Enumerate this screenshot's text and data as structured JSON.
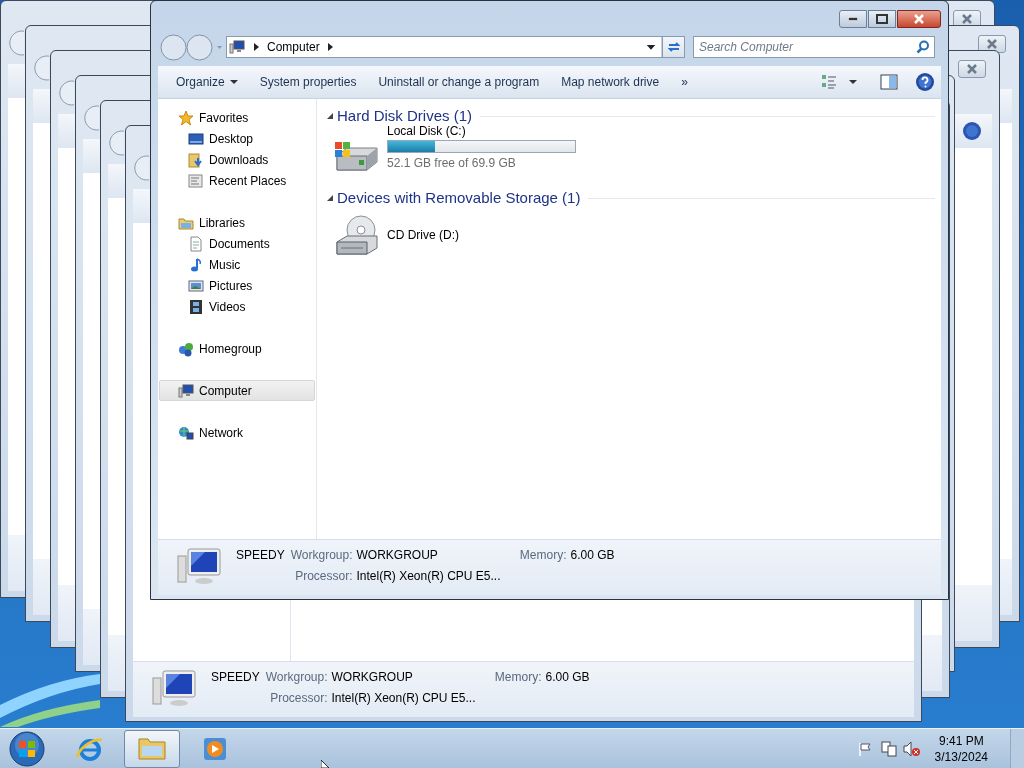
{
  "back_window": {
    "details": {
      "name": "SPEEDY",
      "fields": [
        {
          "label": "Workgroup:",
          "value": "WORKGROUP"
        },
        {
          "label": "Memory:",
          "value": "6.00 GB"
        },
        {
          "label": "Processor:",
          "value": "Intel(R) Xeon(R) CPU E5..."
        }
      ]
    }
  },
  "window": {
    "address": {
      "crumbs": [
        "Computer"
      ]
    },
    "search": {
      "placeholder": "Search Computer"
    },
    "toolbar": [
      {
        "label": "Organize",
        "kind": "menu"
      },
      {
        "label": "System properties",
        "kind": "button"
      },
      {
        "label": "Uninstall or change a program",
        "kind": "button"
      },
      {
        "label": "Map network drive",
        "kind": "button"
      },
      {
        "label": "»",
        "kind": "button"
      }
    ],
    "nav": [
      {
        "label": "Favorites",
        "kind": "star",
        "selected": false,
        "children": [
          {
            "label": "Desktop",
            "kind": "desktop",
            "selected": false
          },
          {
            "label": "Downloads",
            "kind": "downloads",
            "selected": false
          },
          {
            "label": "Recent Places",
            "kind": "recent",
            "selected": false
          }
        ]
      },
      {
        "label": "Libraries",
        "kind": "library",
        "selected": false,
        "children": [
          {
            "label": "Documents",
            "kind": "document",
            "selected": false
          },
          {
            "label": "Music",
            "kind": "music",
            "selected": false
          },
          {
            "label": "Pictures",
            "kind": "pictures",
            "selected": false
          },
          {
            "label": "Videos",
            "kind": "videos",
            "selected": false
          }
        ]
      },
      {
        "label": "Homegroup",
        "kind": "homegroup",
        "selected": false
      },
      {
        "label": "Computer",
        "kind": "computer",
        "selected": true
      },
      {
        "label": "Network",
        "kind": "network",
        "selected": false
      }
    ],
    "groups": [
      {
        "title": "Hard Disk Drives (1)",
        "expanded": true,
        "items": [
          {
            "kind": "hdd",
            "name": "Local Disk (C:)",
            "level": 0.25,
            "free": "52.1 GB free of 69.9 GB"
          }
        ]
      },
      {
        "title": "Devices with Removable Storage (1)",
        "expanded": true,
        "items": [
          {
            "kind": "cd",
            "name": "CD Drive (D:)"
          }
        ]
      }
    ],
    "details": {
      "name": "SPEEDY",
      "fields": [
        {
          "label": "Workgroup:",
          "value": "WORKGROUP"
        },
        {
          "label": "Memory:",
          "value": "6.00 GB"
        },
        {
          "label": "Processor:",
          "value": "Intel(R) Xeon(R) CPU E5..."
        }
      ]
    }
  },
  "taskbar": {
    "apps": [
      {
        "kind": "ie",
        "selected": false
      },
      {
        "kind": "explorer",
        "selected": true
      },
      {
        "kind": "media",
        "selected": false
      }
    ],
    "clock": {
      "time": "9:41 PM",
      "date": "3/13/2024"
    }
  }
}
